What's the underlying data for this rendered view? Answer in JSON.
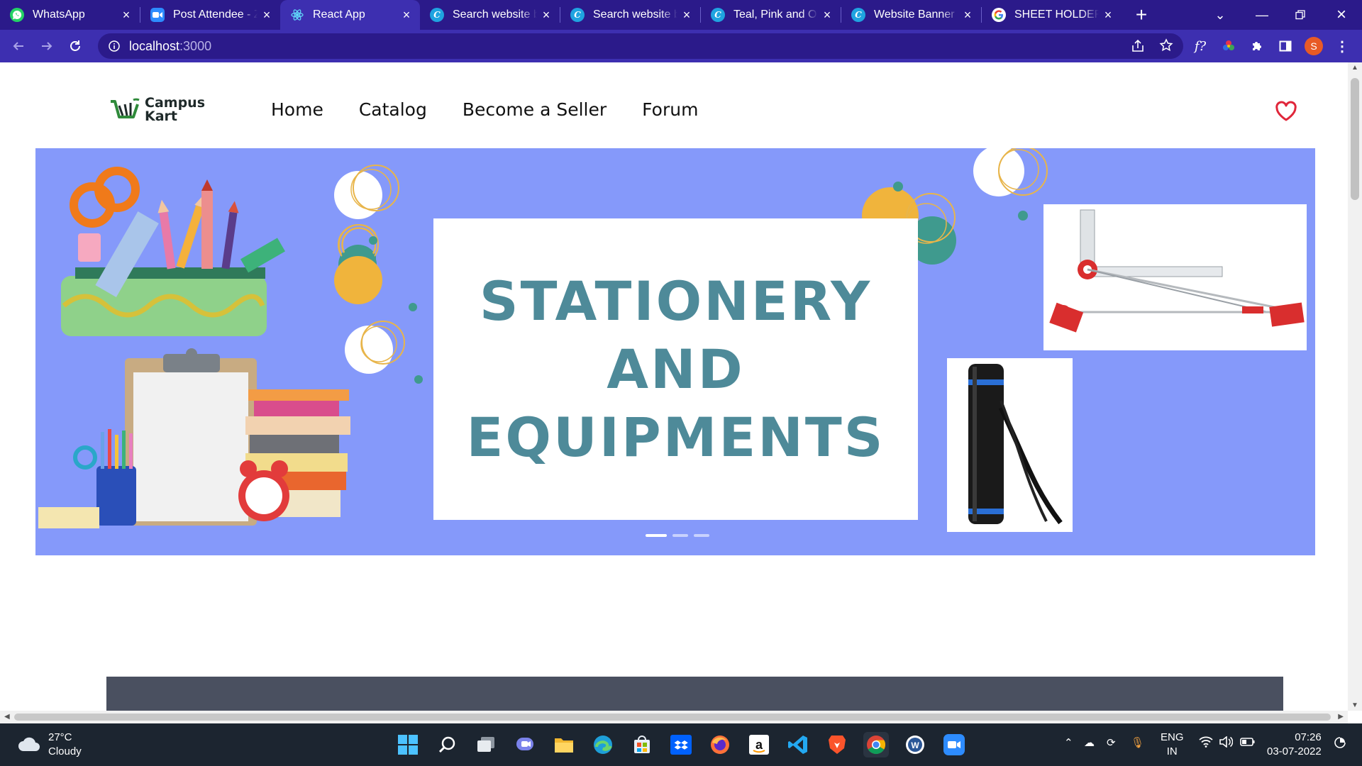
{
  "browser": {
    "tabs": [
      {
        "title": "WhatsApp",
        "icon": "whatsapp-icon",
        "color": "#25d366"
      },
      {
        "title": "Post Attendee - Zoom",
        "icon": "zoom-icon",
        "color": "#2d8cff"
      },
      {
        "title": "React App",
        "icon": "react-icon",
        "color": "#61dafb",
        "active": true
      },
      {
        "title": "Search website banner",
        "icon": "canva-icon",
        "color": "#1fa3e0"
      },
      {
        "title": "Search website banner",
        "icon": "canva-icon",
        "color": "#1fa3e0"
      },
      {
        "title": "Teal, Pink and Orange",
        "icon": "canva-icon",
        "color": "#1fa3e0"
      },
      {
        "title": "Website Banner S",
        "icon": "canva-icon",
        "color": "#1fa3e0"
      },
      {
        "title": "SHEET HOLDER -",
        "icon": "google-icon",
        "color": "#ffffff"
      }
    ],
    "url_host": "localhost",
    "url_port": ":3000",
    "profile_initial": "S",
    "extension_label": "f?"
  },
  "site": {
    "logo_line1": "Campus",
    "logo_line2": "Kart",
    "nav": [
      "Home",
      "Catalog",
      "Become a Seller",
      "Forum"
    ],
    "hero": {
      "lines": [
        "STATIONERY",
        "AND",
        "EQUIPMENTS"
      ],
      "slide_count": 3,
      "active_slide": 1
    }
  },
  "taskbar": {
    "temperature": "27°C",
    "weather": "Cloudy",
    "language": "ENG",
    "region": "IN",
    "time": "07:26",
    "date": "03-07-2022"
  },
  "colors": {
    "tab_strip": "#2b1a8a",
    "toolbar": "#3d2fb0",
    "hero_bg": "#8599fa",
    "hero_text": "#4e8a99",
    "heart": "#e0263a"
  }
}
